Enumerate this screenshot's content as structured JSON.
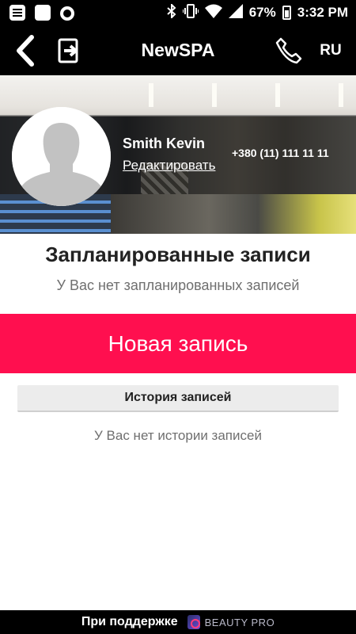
{
  "status_bar": {
    "battery_percent": "67%",
    "time": "3:32 PM",
    "icons": [
      "message-icon",
      "app-notification-icon",
      "circle-icon",
      "bluetooth-icon",
      "vibrate-icon",
      "wifi-icon",
      "signal-icon",
      "battery-icon"
    ]
  },
  "header": {
    "title": "NewSPA",
    "language": "RU",
    "icons": [
      "back-arrow-icon",
      "exit-icon",
      "phone-icon"
    ]
  },
  "profile": {
    "name": "Smith Kevin",
    "edit_label": "Редактировать",
    "phone": "+380 (11) 111 11 11"
  },
  "scheduled": {
    "title": "Запланированные записи",
    "empty_text": "У Вас нет запланированных записей"
  },
  "new_booking_label": "Новая запись",
  "history": {
    "button_label": "История записей",
    "empty_text": "У Вас нет истории записей"
  },
  "footer": {
    "support_text": "При поддержке",
    "brand": "BEAUTY PRO",
    "brand_icon": "beauty-pro-logo"
  },
  "colors": {
    "accent": "#ff0f4f",
    "bar_background": "#000000"
  }
}
